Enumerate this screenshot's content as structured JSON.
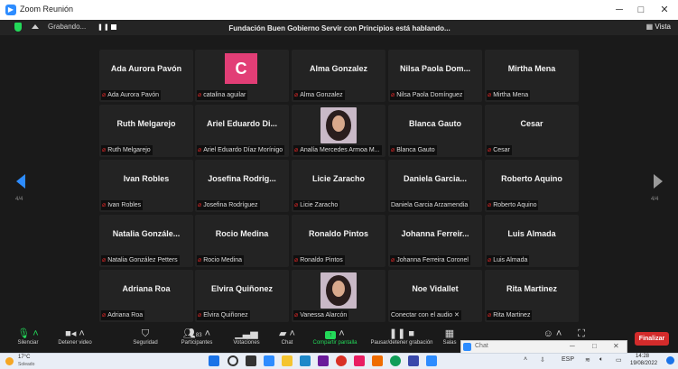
{
  "window": {
    "title": "Zoom Reunión"
  },
  "topbar": {
    "recording_label": "Grabando...",
    "speaking_text": "Fundación Buen Gobierno Servir con Principios está hablando...",
    "view_label": "Vista"
  },
  "pagination": {
    "left": "4/4",
    "right": "4/4"
  },
  "tiles": [
    {
      "name": "Ada Aurora Pavón",
      "label": "Ada Aurora Pavón",
      "muted": true
    },
    {
      "name": "",
      "label": "catalina aguilar",
      "muted": true,
      "avatar_letter": "C",
      "avatar_color": "#e23e76"
    },
    {
      "name": "Alma Gonzalez",
      "label": "Alma Gonzalez",
      "muted": true
    },
    {
      "name": "Nilsa Paola Dom...",
      "label": "Nilsa Paola Domínguez",
      "muted": true
    },
    {
      "name": "Mirtha Mena",
      "label": "Mirtha Mena",
      "muted": true
    },
    {
      "name": "Ruth Melgarejo",
      "label": "Ruth Melgarejo",
      "muted": true
    },
    {
      "name": "Ariel Eduardo Di...",
      "label": "Ariel Eduardo Díaz Morínigo",
      "muted": true
    },
    {
      "name": "",
      "label": "Analía Mercedes Armoa M...",
      "muted": true,
      "photo": true
    },
    {
      "name": "Blanca Gauto",
      "label": "Blanca Gauto",
      "muted": true
    },
    {
      "name": "Cesar",
      "label": "Cesar",
      "muted": true
    },
    {
      "name": "Ivan Robles",
      "label": "Ivan Robles",
      "muted": true
    },
    {
      "name": "Josefina Rodrig...",
      "label": "Josefina Rodríguez",
      "muted": true
    },
    {
      "name": "Licie Zaracho",
      "label": "Licie Zaracho",
      "muted": true
    },
    {
      "name": "Daniela Garcia...",
      "label": "Daniela Garcia Arzamendia",
      "muted": false
    },
    {
      "name": "Roberto Aquino",
      "label": "Roberto Aquino",
      "muted": true
    },
    {
      "name": "Natalia Gonzále...",
      "label": "Natalia González Petters",
      "muted": true
    },
    {
      "name": "Rocio Medina",
      "label": "Rocio Medina",
      "muted": true
    },
    {
      "name": "Ronaldo Pintos",
      "label": "Ronaldo Pintos",
      "muted": true
    },
    {
      "name": "Johanna Ferreir...",
      "label": "Johanna Ferreira Coronel",
      "muted": true
    },
    {
      "name": "Luis Almada",
      "label": "Luis Almada",
      "muted": true
    },
    {
      "name": "Adriana Roa",
      "label": "Adriana Roa",
      "muted": true
    },
    {
      "name": "Elvira Quiñonez",
      "label": "Elvira Quiñonez",
      "muted": true
    },
    {
      "name": "",
      "label": "Vanessa Alarcón",
      "muted": true,
      "photo": true
    },
    {
      "name": "Noe Vidallet",
      "label": "Conectar con el audio ✕",
      "muted": false
    },
    {
      "name": "Rita Martinez",
      "label": "Rita Martinez",
      "muted": true
    }
  ],
  "toolbar": {
    "mute": "Silenciar",
    "stop_video": "Detener video",
    "security": "Seguridad",
    "participants": "Participantes",
    "participants_count": "83",
    "polls": "Votaciones",
    "chat": "Chat",
    "share": "Compartir pantalla",
    "pause_recording": "Pausar/detener grabación",
    "rooms": "Salas",
    "end": "Finalizar"
  },
  "chat_window": {
    "title": "Chat"
  },
  "taskbar": {
    "temperature": "17°C",
    "weather": "Soleado",
    "language": "ESP",
    "time": "14:28",
    "date": "19/08/2022"
  },
  "colors": {
    "accent": "#2d8cff",
    "end_button": "#d32b2b",
    "share_green": "#23d959",
    "muted_red": "#e02828"
  }
}
